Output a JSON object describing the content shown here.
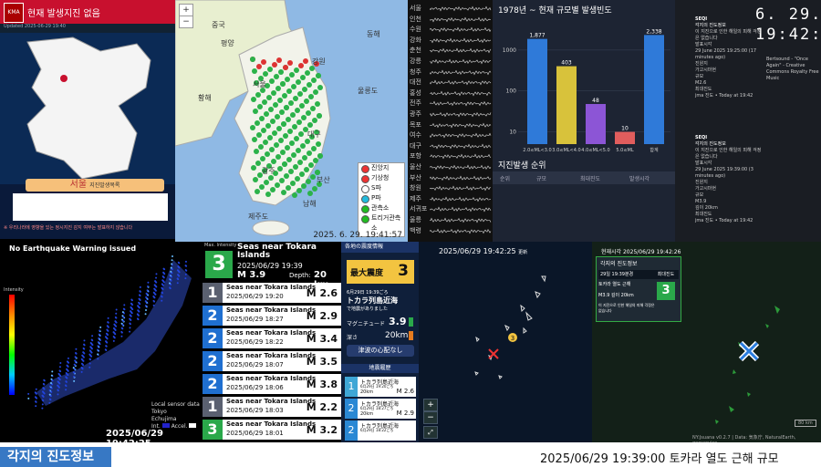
{
  "colors": {
    "intensity1": "#5a6070",
    "intensity2": "#1f6fd0",
    "intensity3": "#2aa84a",
    "alert_red": "#c8102e",
    "accent_blue": "#3778c4",
    "dark_bg": "#0a1628"
  },
  "panel1": {
    "logo": "KMA",
    "title": "현재 발생지진 없음",
    "subtitle": "Updated 2025-06-29 19:40",
    "city": "서울",
    "city_note": "지진발생목록",
    "footer": "※ 우리나라에 영향을 있는 정시지진 감지 여부는 발표하지 않습니다"
  },
  "panel2": {
    "timestamp": "2025. 6. 29. 19:41:57",
    "place_labels": [
      "중국",
      "평양",
      "강원",
      "서울",
      "울릉도",
      "대구",
      "광주",
      "부산",
      "남해",
      "제주도",
      "황해",
      "동해"
    ],
    "legend": [
      {
        "label": "진앙지",
        "color": "#e33"
      },
      {
        "label": "기상청",
        "color": "#e33"
      },
      {
        "label": "S파",
        "color": "#fff"
      },
      {
        "label": "P파",
        "color": "#2bd"
      },
      {
        "label": "관측소",
        "color": "#2b2"
      },
      {
        "label": "트리거관측소",
        "color": "#2b2"
      }
    ],
    "zoom_in": "+",
    "zoom_out": "−"
  },
  "panel3": {
    "stations": [
      "서울",
      "인천",
      "수원",
      "강화",
      "춘천",
      "강릉",
      "청주",
      "대전",
      "홍성",
      "전주",
      "광주",
      "목포",
      "여수",
      "대구",
      "포항",
      "울산",
      "부산",
      "창원",
      "제주",
      "서귀포",
      "울릉",
      "백령"
    ]
  },
  "panel4": {
    "title": "1978년 ~ 현재 규모별 발생빈도",
    "sub_title": "지진발생 순위",
    "table_headers": [
      "순위",
      "규모",
      "최대진도",
      "발생시각"
    ]
  },
  "chart_data": {
    "type": "bar",
    "title": "1978년 ~ 현재 규모별 발생빈도",
    "categories": [
      "2.0≤ML<3.0",
      "3.0≤ML<4.0",
      "4.0≤ML<5.0",
      "5.0≤ML",
      "합계"
    ],
    "values": [
      1877,
      403,
      48,
      10,
      2338
    ],
    "yscale": "log",
    "yticks": [
      "1000",
      "100",
      "10"
    ],
    "colors": [
      "#2f7ad9",
      "#d8c23b",
      "#8c55d6",
      "#e05d5d",
      "#2f7ad9"
    ]
  },
  "panel5": {
    "clock_date": "6. 29.",
    "clock_time": "19:42:2",
    "blocks": [
      {
        "head": "SEQI",
        "title": "각지의 진도정보",
        "lines": [
          "이 지진으로 인한 해일의 피해 걱정은 없습니다",
          "발표시각",
          "29 June 2025 19:25:00 (17 minutes ago)",
          "진원지",
          "가고시마현",
          "규모",
          "M2.6",
          "최대진도",
          "jma 진도 • Today at 19:42"
        ],
        "song": "Bertsound - \"Once Again\" - Creative Commons Royalty Free Music"
      },
      {
        "head": "SEQI",
        "title": "각지의 진도정보",
        "lines": [
          "이 지진으로 인한 해일의 피해 걱정은 없습니다",
          "발표시각",
          "29 June 2025 19:39:00 (3 minutes ago)",
          "진원지",
          "가고시마현",
          "규모",
          "M3.9",
          "깊이 20km",
          "최대진도",
          "jma 진도 • Today at 19:42"
        ]
      }
    ]
  },
  "panel6": {
    "warning": "No Earthquake Warning issued",
    "scale_label": "Intensity",
    "sensor_title": "Local sensor data",
    "sensor_city": "Tokyo",
    "sensor_city2": "Echujima",
    "sensor_legend": [
      "Int.",
      "Accel."
    ],
    "timestamp": "2025/06/29 19:42:25"
  },
  "panel7": {
    "head": {
      "label": "Max. Intensity",
      "num": "3",
      "name": "Seas near Tokara Islands",
      "date": "2025/06/29 19:39",
      "mag": "M 3.9",
      "depth_label": "Depth:",
      "depth": "20 km"
    },
    "rows": [
      {
        "num": "1",
        "name": "Seas near Tokara Islands",
        "date": "2025/06/29 19:20",
        "mag": "M 2.6"
      },
      {
        "num": "2",
        "name": "Seas near Tokara Islands",
        "date": "2025/06/29 18:27",
        "mag": "M 2.9"
      },
      {
        "num": "2",
        "name": "Seas near Tokara Islands",
        "date": "2025/06/29 18:22",
        "mag": "M 3.4"
      },
      {
        "num": "2",
        "name": "Seas near Tokara Islands",
        "date": "2025/06/29 18:07",
        "mag": "M 3.5"
      },
      {
        "num": "2",
        "name": "Seas near Tokara Islands",
        "date": "2025/06/29 18:06",
        "mag": "M 3.8"
      },
      {
        "num": "1",
        "name": "Seas near Tokara Islands",
        "date": "2025/06/29 18:03",
        "mag": "M 2.2"
      },
      {
        "num": "3",
        "name": "Seas near Tokara Islands",
        "date": "2025/06/29 18:01",
        "mag": "M 3.2"
      }
    ]
  },
  "panel8": {
    "head": "各地の震度情報",
    "maxlabel": "最大震度",
    "maxval": "3",
    "time": "6月29日 19:39ごろ",
    "place": "トカラ列島近海",
    "desc": "で地震がありました",
    "mag_label": "マグニチュード",
    "mag": "3.9",
    "depth_label": "深さ",
    "depth": "20km",
    "tsunami": "津波の心配なし",
    "history": "地震履歴",
    "hist": [
      {
        "int": "1",
        "place": "トカラ列島近海",
        "time": "6月29日 19:20ごろ",
        "depth": "20km",
        "mag": "M 2.6"
      },
      {
        "int": "2",
        "place": "トカラ列島近海",
        "time": "6月29日 18:27ごろ",
        "depth": "20km",
        "mag": "M 2.9"
      },
      {
        "int": "2",
        "place": "トカラ列島近海",
        "time": "6月29日 18:22ごろ",
        "depth": "",
        "mag": ""
      }
    ]
  },
  "panel9": {
    "timestamp": "2025/06/29 19:42:25",
    "ts_suffix": "更新",
    "zoom_in": "+",
    "zoom_out": "−",
    "marker": "3"
  },
  "panel10": {
    "clock": "현재시각  2025/06/29 19:42:26",
    "card_title": "각지의 진도정보",
    "card_time": "29일 19:39분경",
    "card_maxlabel": "최대진도",
    "card_place": "토카라 열도 근해",
    "card_val": "3",
    "card_mag": "M3.9",
    "card_depth": "깊이 20km",
    "card_note": "이 지진으로 인한 해일의 피해 걱정은 없습니다",
    "attribution": "NY:Jsuana v0.2.7 | Data: 気象庁, NaturalEarth, geoservice",
    "scale": "80 km"
  },
  "bottom": {
    "tag": "각지의 진도정보",
    "ticker": "2025/06/29 19:39:00    토카라 열도 근해    규모"
  }
}
